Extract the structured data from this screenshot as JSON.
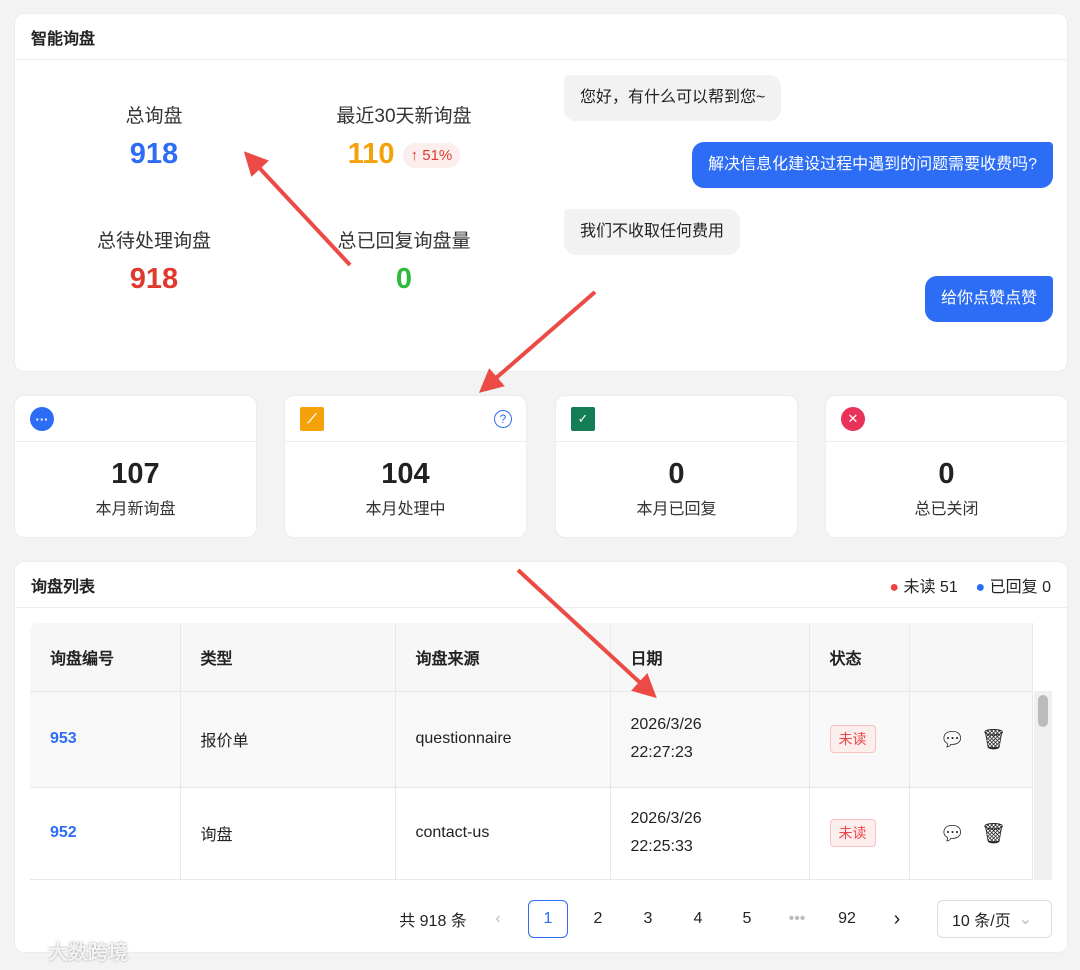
{
  "smart": {
    "title": "智能询盘",
    "stats": [
      {
        "label": "总询盘",
        "value": "918",
        "color": "#2d6df6"
      },
      {
        "label": "最近30天新询盘",
        "value": "110",
        "color": "#f5a20a",
        "trend": "↑ 51%"
      },
      {
        "label": "总待处理询盘",
        "value": "918",
        "color": "#e03a2f"
      },
      {
        "label": "总已回复询盘量",
        "value": "0",
        "color": "#2dba3c"
      }
    ],
    "chat": [
      "您好，有什么可以帮到您~",
      "解决信息化建设过程中遇到的问题需要收费吗?",
      "我们不收取任何费用",
      "给你点赞点赞"
    ]
  },
  "cards": [
    {
      "icon": "chat-bubble-icon",
      "value": "107",
      "label": "本月新询盘",
      "color": "#2d6df6"
    },
    {
      "icon": "trend-chart-icon",
      "value": "104",
      "label": "本月处理中",
      "color": "#f5a20a"
    },
    {
      "icon": "calendar-check-icon",
      "value": "0",
      "label": "本月已回复",
      "color": "#137d55"
    },
    {
      "icon": "close-circle-icon",
      "value": "0",
      "label": "总已关闭",
      "color": "#e8325a"
    }
  ],
  "list": {
    "title": "询盘列表",
    "unread": "未读 51",
    "replied": "已回复 0",
    "columns": [
      "询盘编号",
      "类型",
      "询盘来源",
      "日期",
      "状态",
      ""
    ],
    "rows": [
      {
        "id": "953",
        "type": "报价单",
        "source": "questionnaire",
        "date": "2026/3/26",
        "time": "22:27:23",
        "status": "未读"
      },
      {
        "id": "952",
        "type": "询盘",
        "source": "contact-us",
        "date": "2026/3/26",
        "time": "22:25:33",
        "status": "未读"
      }
    ],
    "pagination": {
      "total": "共 918 条",
      "pages": [
        "1",
        "2",
        "3",
        "4",
        "5",
        "92"
      ],
      "current": "1",
      "page_size": "10 条/页"
    }
  },
  "watermark": "大数跨境"
}
